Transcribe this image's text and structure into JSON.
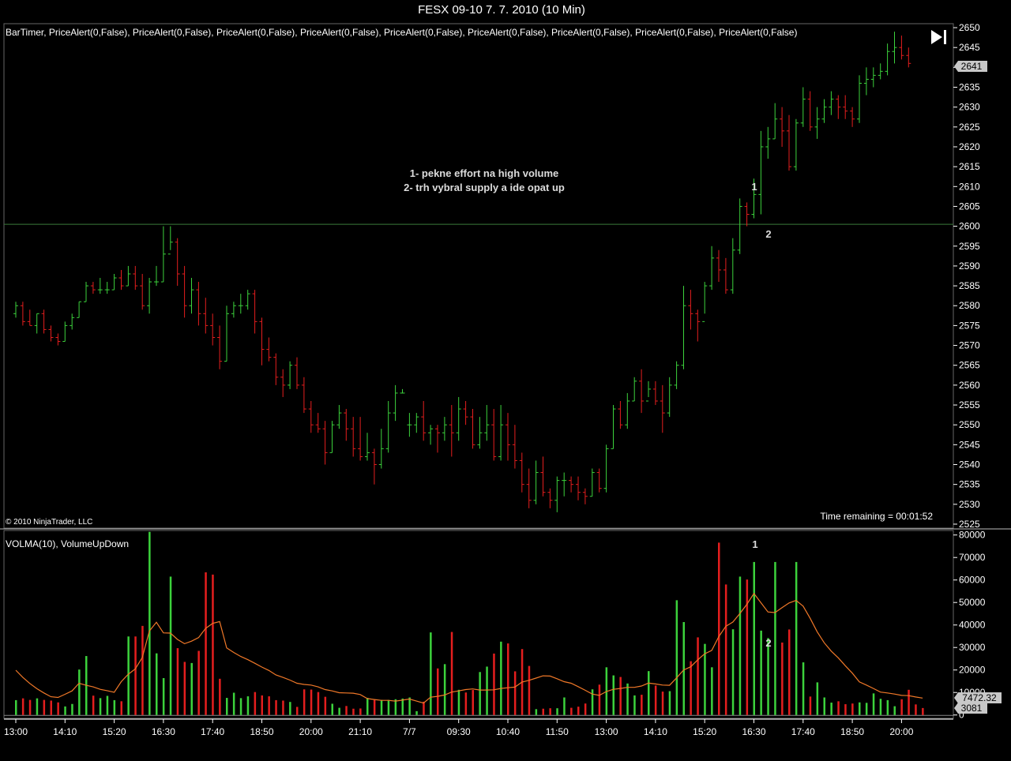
{
  "window": {
    "title": "FESX 09-10  7. 7. 2010 (10 Min)"
  },
  "price_panel": {
    "indicators_label": "BarTimer, PriceAlert(0,False), PriceAlert(0,False),  PriceAlert(0,False), PriceAlert(0,False), PriceAlert(0,False), PriceAlert(0,False),  PriceAlert(0,False), PriceAlert(0,False), PriceAlert(0,False)",
    "copyright": "© 2010 NinjaTrader, LLC",
    "time_remaining": "Time remaining = 00:01:52",
    "annotation_line1": "1- pekne effort na high volume",
    "annotation_line2": "2- trh vybral supply a ide opat up",
    "marker1": "1",
    "marker2": "2",
    "last_price_label": "2641"
  },
  "volume_panel": {
    "indicators_label": "VOLMA(10), VolumeUpDown",
    "marker1": "1",
    "marker2": "2",
    "volma_value_label": "7472.32",
    "last_volume_label": "3081"
  },
  "colors": {
    "up": "#3cd23c",
    "down": "#e41e1e",
    "volma": "#f07828",
    "line": "#3a7a3a",
    "background": "#000000",
    "axis": "#ffffff"
  },
  "chart_data": [
    {
      "type": "ohlc",
      "title": "FESX 09-10  7. 7. 2010 (10 Min)",
      "ylim": [
        2524,
        2651
      ],
      "y_ticks": [
        2525,
        2530,
        2535,
        2540,
        2545,
        2550,
        2555,
        2560,
        2565,
        2570,
        2575,
        2580,
        2585,
        2590,
        2595,
        2600,
        2605,
        2610,
        2615,
        2620,
        2625,
        2630,
        2635,
        2640,
        2645,
        2650
      ],
      "x_tick_labels": [
        "13:00",
        "14:10",
        "15:20",
        "16:30",
        "17:40",
        "18:50",
        "20:00",
        "21:10",
        "7/7",
        "09:30",
        "10:40",
        "11:50",
        "13:00",
        "14:10",
        "15:20",
        "16:30",
        "17:40",
        "18:50",
        "20:00"
      ],
      "x_tick_index": [
        0,
        7,
        14,
        21,
        28,
        35,
        42,
        49,
        56,
        63,
        70,
        77,
        84,
        91,
        98,
        105,
        112,
        119,
        126
      ],
      "horizontal_line": 2600.5,
      "bars": [
        [
          2578,
          2581,
          2577,
          2580
        ],
        [
          2580,
          2581,
          2575,
          2576
        ],
        [
          2576,
          2579,
          2575,
          2575
        ],
        [
          2575,
          2578,
          2573,
          2578
        ],
        [
          2578,
          2579,
          2573,
          2574
        ],
        [
          2574,
          2575,
          2571,
          2572
        ],
        [
          2572,
          2573,
          2570,
          2571
        ],
        [
          2571,
          2576,
          2571,
          2575
        ],
        [
          2575,
          2578,
          2574,
          2577
        ],
        [
          2577,
          2581,
          2577,
          2581
        ],
        [
          2581,
          2586,
          2581,
          2585
        ],
        [
          2585,
          2586,
          2583,
          2584
        ],
        [
          2584,
          2587,
          2583,
          2584
        ],
        [
          2584,
          2586,
          2583,
          2584
        ],
        [
          2584,
          2588,
          2584,
          2587
        ],
        [
          2587,
          2589,
          2584,
          2585
        ],
        [
          2585,
          2590,
          2585,
          2588
        ],
        [
          2588,
          2590,
          2584,
          2585
        ],
        [
          2585,
          2588,
          2579,
          2580
        ],
        [
          2580,
          2587,
          2578,
          2586
        ],
        [
          2586,
          2590,
          2585,
          2586
        ],
        [
          2586,
          2600,
          2586,
          2593
        ],
        [
          2593,
          2600,
          2594,
          2596
        ],
        [
          2596,
          2597,
          2585,
          2588
        ],
        [
          2588,
          2590,
          2577,
          2580
        ],
        [
          2580,
          2587,
          2578,
          2584
        ],
        [
          2584,
          2586,
          2575,
          2578
        ],
        [
          2578,
          2582,
          2573,
          2575
        ],
        [
          2575,
          2578,
          2570,
          2572
        ],
        [
          2572,
          2575,
          2564,
          2566
        ],
        [
          2566,
          2580,
          2566,
          2578
        ],
        [
          2578,
          2581,
          2577,
          2580
        ],
        [
          2580,
          2583,
          2578,
          2580
        ],
        [
          2580,
          2584,
          2579,
          2583
        ],
        [
          2583,
          2584,
          2573,
          2576
        ],
        [
          2576,
          2577,
          2565,
          2569
        ],
        [
          2569,
          2572,
          2566,
          2567
        ],
        [
          2567,
          2568,
          2560,
          2562
        ],
        [
          2562,
          2564,
          2557,
          2560
        ],
        [
          2560,
          2566,
          2559,
          2565
        ],
        [
          2565,
          2567,
          2559,
          2560
        ],
        [
          2560,
          2562,
          2553,
          2554
        ],
        [
          2554,
          2556,
          2548,
          2550
        ],
        [
          2550,
          2553,
          2548,
          2549
        ],
        [
          2549,
          2551,
          2540,
          2543
        ],
        [
          2543,
          2551,
          2543,
          2550
        ],
        [
          2550,
          2555,
          2549,
          2553
        ],
        [
          2553,
          2554,
          2546,
          2549
        ],
        [
          2549,
          2552,
          2542,
          2544
        ],
        [
          2544,
          2552,
          2541,
          2542
        ],
        [
          2542,
          2548,
          2541,
          2543
        ],
        [
          2543,
          2544,
          2535,
          2540
        ],
        [
          2540,
          2549,
          2539,
          2544
        ],
        [
          2544,
          2556,
          2543,
          2553
        ],
        [
          2553,
          2560,
          2551,
          2558
        ],
        [
          2558,
          2559,
          2558,
          2558
        ],
        [
          2550,
          2553,
          2547,
          2550
        ],
        [
          2550,
          2553,
          2548,
          2552
        ],
        [
          2552,
          2556,
          2546,
          2548
        ],
        [
          2548,
          2550,
          2545,
          2549
        ],
        [
          2549,
          2550,
          2543,
          2548
        ],
        [
          2548,
          2552,
          2546,
          2550
        ],
        [
          2550,
          2555,
          2542,
          2548
        ],
        [
          2548,
          2557,
          2546,
          2554
        ],
        [
          2554,
          2556,
          2550,
          2552
        ],
        [
          2552,
          2554,
          2544,
          2545
        ],
        [
          2545,
          2552,
          2544,
          2548
        ],
        [
          2548,
          2555,
          2546,
          2550
        ],
        [
          2550,
          2554,
          2541,
          2542
        ],
        [
          2542,
          2555,
          2541,
          2550
        ],
        [
          2550,
          2553,
          2541,
          2545
        ],
        [
          2545,
          2550,
          2539,
          2541
        ],
        [
          2541,
          2543,
          2533,
          2535
        ],
        [
          2535,
          2539,
          2529,
          2531
        ],
        [
          2531,
          2541,
          2530,
          2538
        ],
        [
          2538,
          2542,
          2532,
          2533
        ],
        [
          2533,
          2534,
          2529,
          2531
        ],
        [
          2531,
          2537,
          2528,
          2536
        ],
        [
          2536,
          2538,
          2532,
          2536
        ],
        [
          2536,
          2537,
          2533,
          2535
        ],
        [
          2535,
          2537,
          2531,
          2533
        ],
        [
          2533,
          2534,
          2530,
          2532
        ],
        [
          2532,
          2539,
          2532,
          2538
        ],
        [
          2538,
          2539,
          2533,
          2534
        ],
        [
          2534,
          2545,
          2533,
          2544
        ],
        [
          2544,
          2555,
          2544,
          2554
        ],
        [
          2554,
          2556,
          2549,
          2550
        ],
        [
          2550,
          2558,
          2549,
          2556
        ],
        [
          2556,
          2562,
          2556,
          2561
        ],
        [
          2561,
          2564,
          2553,
          2556
        ],
        [
          2556,
          2561,
          2557,
          2559
        ],
        [
          2559,
          2561,
          2555,
          2556
        ],
        [
          2556,
          2560,
          2548,
          2553
        ],
        [
          2553,
          2562,
          2552,
          2560
        ],
        [
          2560,
          2566,
          2559,
          2565
        ],
        [
          2565,
          2585,
          2564,
          2580
        ],
        [
          2580,
          2584,
          2574,
          2578
        ],
        [
          2578,
          2579,
          2571,
          2576
        ],
        [
          2576,
          2586,
          2578,
          2585
        ],
        [
          2585,
          2595,
          2584,
          2592
        ],
        [
          2592,
          2594,
          2586,
          2589
        ],
        [
          2589,
          2592,
          2583,
          2584
        ],
        [
          2584,
          2597,
          2583,
          2594
        ],
        [
          2594,
          2607,
          2593,
          2605
        ],
        [
          2605,
          2606,
          2600,
          2603
        ],
        [
          2603,
          2612,
          2602,
          2608
        ],
        [
          2608,
          2624,
          2603,
          2620
        ],
        [
          2620,
          2625,
          2617,
          2622
        ],
        [
          2622,
          2631,
          2622,
          2627
        ],
        [
          2627,
          2630,
          2620,
          2624
        ],
        [
          2624,
          2628,
          2614,
          2615
        ],
        [
          2615,
          2627,
          2614,
          2626
        ],
        [
          2626,
          2635,
          2625,
          2632
        ],
        [
          2632,
          2634,
          2624,
          2625
        ],
        [
          2625,
          2630,
          2622,
          2627
        ],
        [
          2627,
          2632,
          2626,
          2630
        ],
        [
          2630,
          2634,
          2628,
          2632
        ],
        [
          2632,
          2633,
          2627,
          2630
        ],
        [
          2630,
          2633,
          2627,
          2629
        ],
        [
          2629,
          2630,
          2625,
          2627
        ],
        [
          2627,
          2638,
          2626,
          2636
        ],
        [
          2636,
          2640,
          2633,
          2637
        ],
        [
          2637,
          2640,
          2635,
          2638
        ],
        [
          2638,
          2641,
          2637,
          2639
        ],
        [
          2639,
          2646,
          2638,
          2644
        ],
        [
          2644,
          2649,
          2641,
          2645
        ],
        [
          2645,
          2648,
          2642,
          2643
        ],
        [
          2643,
          2645,
          2640,
          2641
        ]
      ]
    },
    {
      "type": "bar",
      "title": "VOLMA(10), VolumeUpDown",
      "ylim": [
        -1500,
        82000
      ],
      "y_ticks": [
        0,
        10000,
        20000,
        30000,
        40000,
        50000,
        60000,
        70000,
        80000
      ],
      "volume": [
        6600,
        7400,
        6700,
        7400,
        6700,
        6400,
        5600,
        3800,
        4900,
        20200,
        26200,
        8600,
        7500,
        8500,
        6600,
        6100,
        34900,
        34900,
        39600,
        81400,
        27400,
        16400,
        61500,
        29700,
        23600,
        23100,
        28500,
        63400,
        62400,
        16100,
        7600,
        9900,
        7500,
        8300,
        10200,
        8700,
        8300,
        6600,
        6400,
        5800,
        3600,
        11400,
        11300,
        10200,
        8100,
        5000,
        3200,
        4000,
        2800,
        2900,
        7600,
        6700,
        6700,
        6700,
        7000,
        7300,
        7800,
        1700,
        5900,
        36700,
        20700,
        22600,
        36900,
        11200,
        10000,
        11100,
        19100,
        21500,
        27300,
        32600,
        31800,
        19400,
        29300,
        21800,
        2600,
        2800,
        3000,
        3000,
        7800,
        3200,
        3700,
        5100,
        11400,
        13500,
        21200,
        17600,
        16900,
        14000,
        8700,
        9000,
        19500,
        13100,
        10400,
        10600,
        51000,
        41300,
        23900,
        34500,
        31600,
        21200,
        76600,
        58000,
        38100,
        61500,
        60200,
        68000,
        37500,
        34200,
        68000,
        32200,
        38000,
        68000,
        23400,
        8200,
        14500,
        7800,
        5500,
        6100,
        4800,
        5100,
        5600,
        5400,
        9600,
        7200,
        6600,
        3900,
        7000,
        11200,
        4700,
        3100
      ],
      "volma": [
        19900,
        16700,
        14000,
        11700,
        9800,
        8100,
        7800,
        9200,
        10700,
        14100,
        13200,
        12500,
        11400,
        10800,
        10100,
        14800,
        18100,
        20500,
        25600,
        37300,
        41200,
        36500,
        36400,
        33600,
        31700,
        32800,
        34400,
        38500,
        40700,
        41500,
        29800,
        27800,
        26000,
        24600,
        23000,
        21300,
        19800,
        17800,
        16700,
        15500,
        14100,
        13600,
        13300,
        12500,
        11300,
        10700,
        9900,
        9800,
        9700,
        9100,
        7300,
        6900,
        6500,
        6500,
        6200,
        6600,
        7100,
        6200,
        5300,
        7900,
        8300,
        8900,
        10200,
        10700,
        11300,
        11600,
        11100,
        11100,
        11200,
        11800,
        12100,
        12400,
        14600,
        15400,
        16400,
        17400,
        17300,
        16100,
        14800,
        14100,
        12600,
        11000,
        9300,
        8700,
        10400,
        11400,
        11800,
        12300,
        12300,
        12900,
        14200,
        13800,
        13300,
        13200,
        16500,
        20000,
        21400,
        24500,
        27200,
        28700,
        34800,
        39400,
        41300,
        45100,
        49200,
        54000,
        49900,
        45800,
        45500,
        47700,
        49800,
        50900,
        48400,
        43000,
        37000,
        32100,
        28400,
        25400,
        21900,
        18600,
        14700,
        13300,
        11800,
        10200,
        9800,
        9300,
        8700,
        8600,
        8000,
        7500
      ]
    }
  ]
}
